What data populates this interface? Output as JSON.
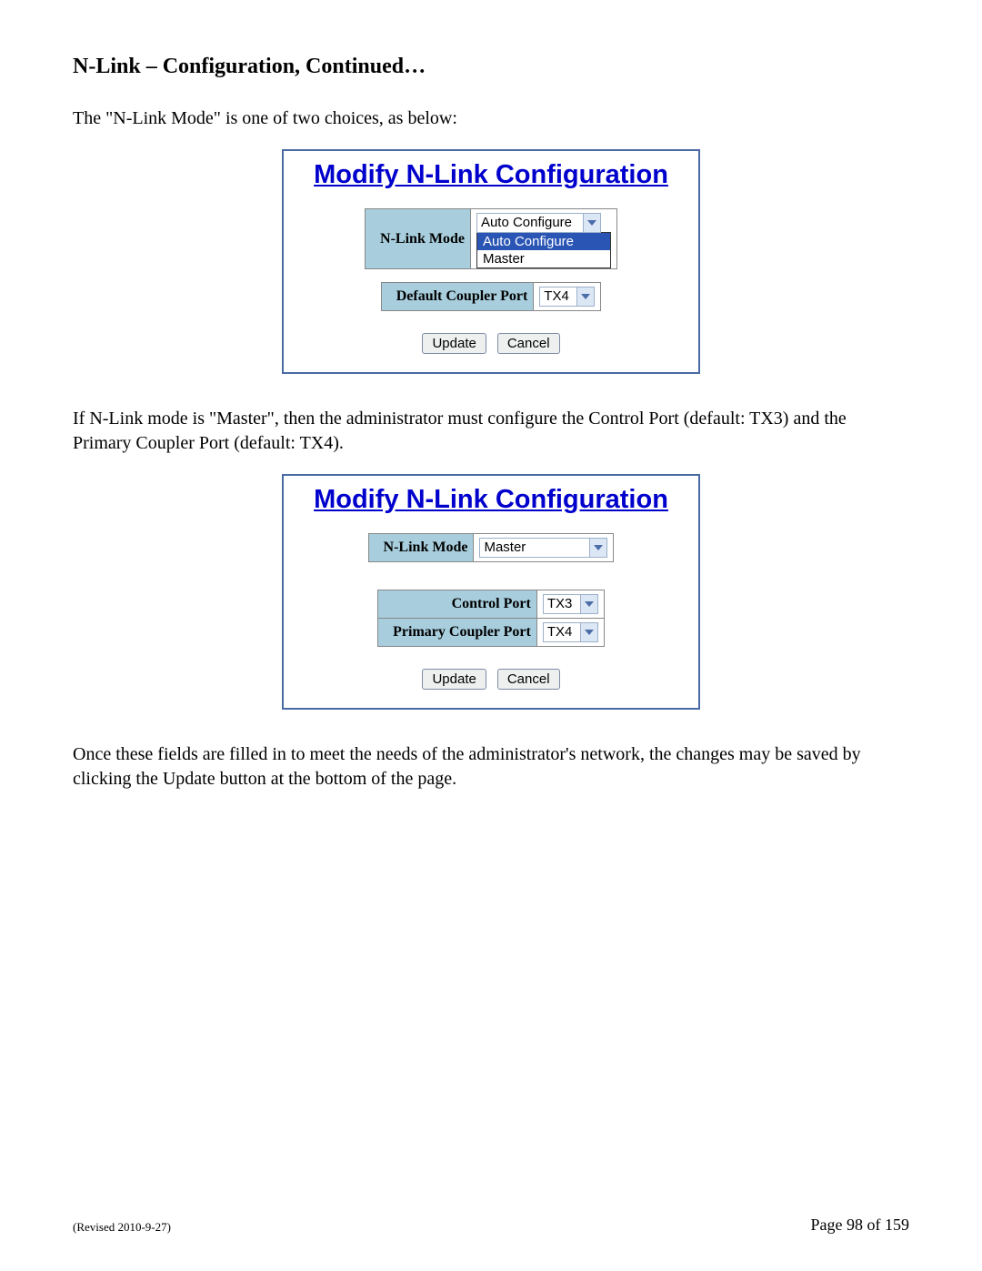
{
  "heading": "N-Link – Configuration, Continued…",
  "para1": "The \"N-Link Mode\" is one of two choices, as below:",
  "panel1": {
    "title": "Modify N-Link Configuration",
    "mode_label": "N-Link Mode",
    "mode_value": "Auto Configure",
    "dropdown": {
      "opt1": "Auto Configure",
      "opt2": "Master"
    },
    "coupler_label": "Default Coupler Port",
    "coupler_value": "TX4",
    "update": "Update",
    "cancel": "Cancel"
  },
  "para2": "If N-Link mode is \"Master\", then the administrator must configure the Control Port (default: TX3) and the Primary Coupler Port (default: TX4).",
  "panel2": {
    "title": "Modify N-Link Configuration",
    "mode_label": "N-Link Mode",
    "mode_value": "Master",
    "control_label": "Control Port",
    "control_value": "TX3",
    "coupler_label": "Primary Coupler Port",
    "coupler_value": "TX4",
    "update": "Update",
    "cancel": "Cancel"
  },
  "para3": "Once these fields are filled in to meet the needs of the administrator's network, the changes may be saved by clicking the Update button at the bottom of the page.",
  "footer": {
    "revised": "(Revised 2010-9-27)",
    "page": "Page 98 of 159"
  }
}
